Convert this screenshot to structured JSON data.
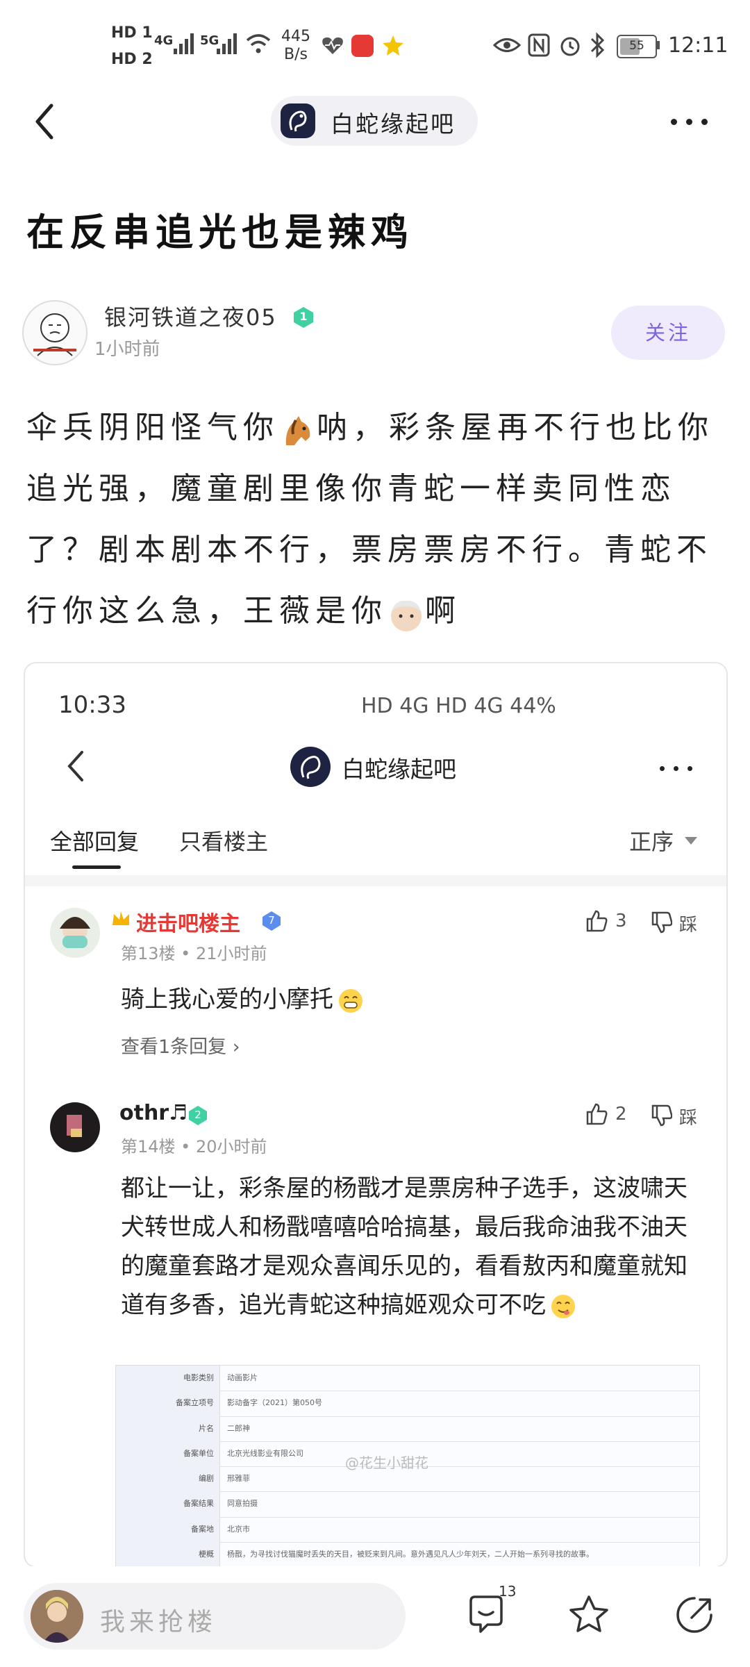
{
  "status_bar": {
    "hd1": "HD 1",
    "hd2": "HD 2",
    "net1": "4G",
    "net2": "5G",
    "speed": "445",
    "speed_unit": "B/s",
    "battery": "55",
    "time": "12:11"
  },
  "nav": {
    "forum_name": "白蛇缘起吧"
  },
  "post": {
    "title": "在反串追光也是辣鸡",
    "author": "银河铁道之夜05",
    "level": "1",
    "time": "1小时前",
    "follow_label": "关注",
    "body_part1": "伞兵阴阳怪气你",
    "body_part2": "呐，彩条屋再不行也比你追光强，魔童剧里像你青蛇一样卖同性恋了？剧本剧本不行，票房票房不行。青蛇不行你这么急，王薇是你",
    "body_part3": "啊",
    "emojis": [
      "horse-emoji",
      "old-man-emoji"
    ]
  },
  "embedded": {
    "time": "10:33",
    "sys": "HD 4G HD 4G 44%",
    "forum_name": "白蛇缘起吧",
    "tab_all": "全部回复",
    "tab_op": "只看楼主",
    "sort": "正序",
    "comments": [
      {
        "name": "进击吧楼主",
        "level": "7",
        "meta": "第13楼 • 21小时前",
        "likes": "3",
        "dislike": "踩",
        "text": "骑上我心爱的小摩托",
        "more": "查看1条回复 ›",
        "name_color": "#e53935"
      },
      {
        "name": "othr♬",
        "level": "2",
        "meta": "第14楼 • 20小时前",
        "likes": "2",
        "dislike": "踩",
        "text": "都让一让，彩条屋的杨戬才是票房种子选手，这波啸天犬转世成人和杨戬嘻嘻哈哈搞基，最后我命油我不油天的魔童套路才是观众喜闻乐见的，看看敖丙和魔童就知道有多香，追光青蛇这种搞姬观众可不吃",
        "name_color": "#222222"
      }
    ],
    "doc_rows": [
      [
        "电影类别",
        "动画影片"
      ],
      [
        "备案立项号",
        "影动备字（2021）第050号"
      ],
      [
        "片名",
        "二郎神"
      ],
      [
        "备案单位",
        "北京光线影业有限公司"
      ],
      [
        "编剧",
        "邢雅菲"
      ],
      [
        "备案结果",
        "同意拍摄"
      ],
      [
        "备案地",
        "北京市"
      ],
      [
        "梗概",
        "杨戬，为寻找讨伐猫魔时丢失的天目，被贬来到凡间。意外遇见凡人少年刘天，二人开始一系列寻找的故事。"
      ]
    ],
    "doc_watermark": "@花生小甜花"
  },
  "bottom_bar": {
    "reply_placeholder": "我来抢楼",
    "comment_count": "13"
  },
  "colors": {
    "accent": "#7a63e6",
    "follow_bg": "#efeafc",
    "red_name": "#e53935"
  }
}
